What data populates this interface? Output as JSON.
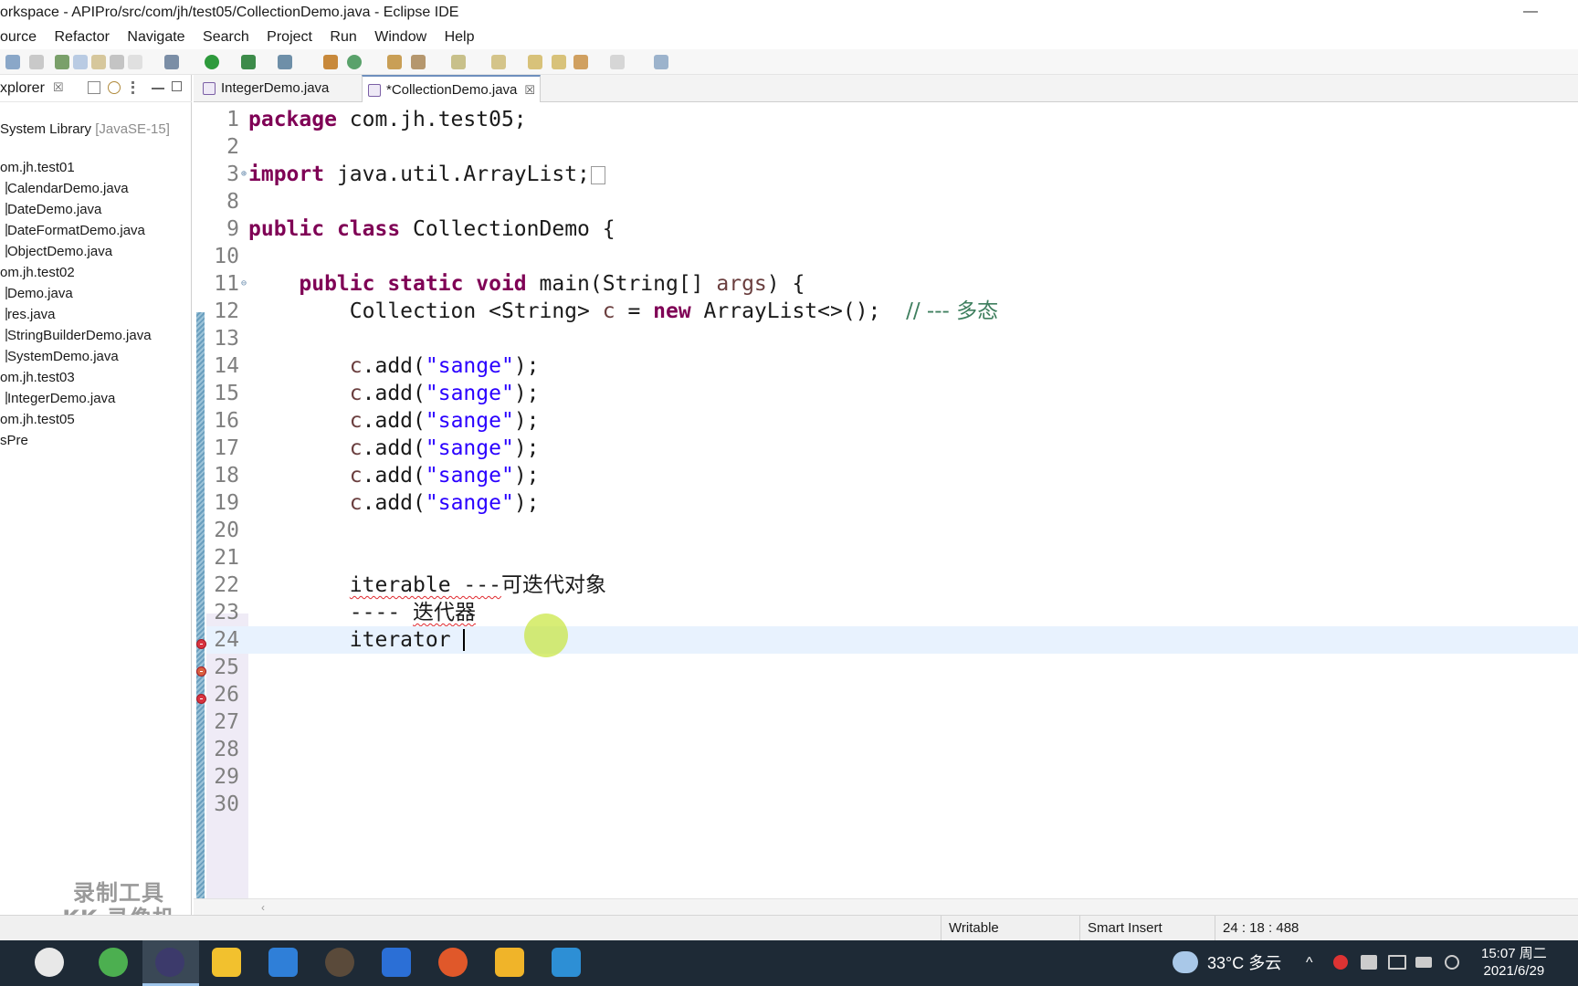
{
  "window": {
    "title": "orkspace - APIPro/src/com/jh/test05/CollectionDemo.java - Eclipse IDE",
    "minimize_glyph": "—"
  },
  "menu": [
    "ource",
    "Refactor",
    "Navigate",
    "Search",
    "Project",
    "Run",
    "Window",
    "Help"
  ],
  "explorer": {
    "title": "xplorer",
    "close_glyph": "☒",
    "items": [
      {
        "label": "System Library",
        "suffix": "[JavaSE-15]",
        "kind": "library"
      },
      {
        "label": "om.jh.test01",
        "kind": "package"
      },
      {
        "label": "CalendarDemo.java",
        "kind": "file"
      },
      {
        "label": "DateDemo.java",
        "kind": "file"
      },
      {
        "label": "DateFormatDemo.java",
        "kind": "file"
      },
      {
        "label": "ObjectDemo.java",
        "kind": "file"
      },
      {
        "label": "om.jh.test02",
        "kind": "package"
      },
      {
        "label": "Demo.java",
        "kind": "file"
      },
      {
        "label": "res.java",
        "kind": "file"
      },
      {
        "label": "StringBuilderDemo.java",
        "kind": "file"
      },
      {
        "label": "SystemDemo.java",
        "kind": "file"
      },
      {
        "label": "om.jh.test03",
        "kind": "package"
      },
      {
        "label": "IntegerDemo.java",
        "kind": "file"
      },
      {
        "label": "om.jh.test05",
        "kind": "package"
      },
      {
        "label": "sPre",
        "kind": "project"
      }
    ]
  },
  "watermark": {
    "line1": "录制工具",
    "line2": "KK 录像机"
  },
  "tabs": [
    {
      "label": "IntegerDemo.java",
      "active": false
    },
    {
      "label": "*CollectionDemo.java",
      "active": true,
      "close_glyph": "☒"
    }
  ],
  "code": {
    "line_numbers": [
      "1",
      "2",
      "3",
      "8",
      "9",
      "10",
      "11",
      "12",
      "13",
      "14",
      "15",
      "16",
      "17",
      "18",
      "19",
      "20",
      "21",
      "22",
      "23",
      "24",
      "25",
      "26",
      "27",
      "28",
      "29",
      "30"
    ],
    "pkg_kw": "package",
    "pkg_name": " com.jh.test05;",
    "imp_kw": "import",
    "imp_name": " java.util.ArrayList;",
    "cls_kw1": "public",
    "cls_kw2": " class",
    "cls_name": " CollectionDemo {",
    "m_kw1": "public",
    "m_kw2": " static",
    "m_kw3": " void",
    "m_name": " main(String[] ",
    "m_args": "args",
    "m_end": ") {",
    "col_type": "Collection <String> ",
    "col_var": "c",
    "col_eq": " = ",
    "col_new": "new",
    "col_rest": " ArrayList<>();  ",
    "col_cmt": "// --- 多态",
    "add_var": "c",
    "add_call": ".add(",
    "add_str": "\"sange\"",
    "add_end": ");",
    "l22_a": "iterable ---",
    "l22_b": "可迭代对象",
    "l23_a": "----",
    "l23_b": "迭代器",
    "l24": "iterator "
  },
  "status": {
    "writable": "Writable",
    "insert_mode": "Smart Insert",
    "position": "24 : 18 : 488"
  },
  "taskbar": {
    "weather": "33°C  多云",
    "time": "15:07 周二",
    "date": "2021/6/29"
  },
  "colors": {
    "keyword": "#7f0055",
    "string": "#2a00ff",
    "comment": "#3f7f5f",
    "current_line": "#e8f2fe",
    "taskbar": "#1e2a36"
  }
}
